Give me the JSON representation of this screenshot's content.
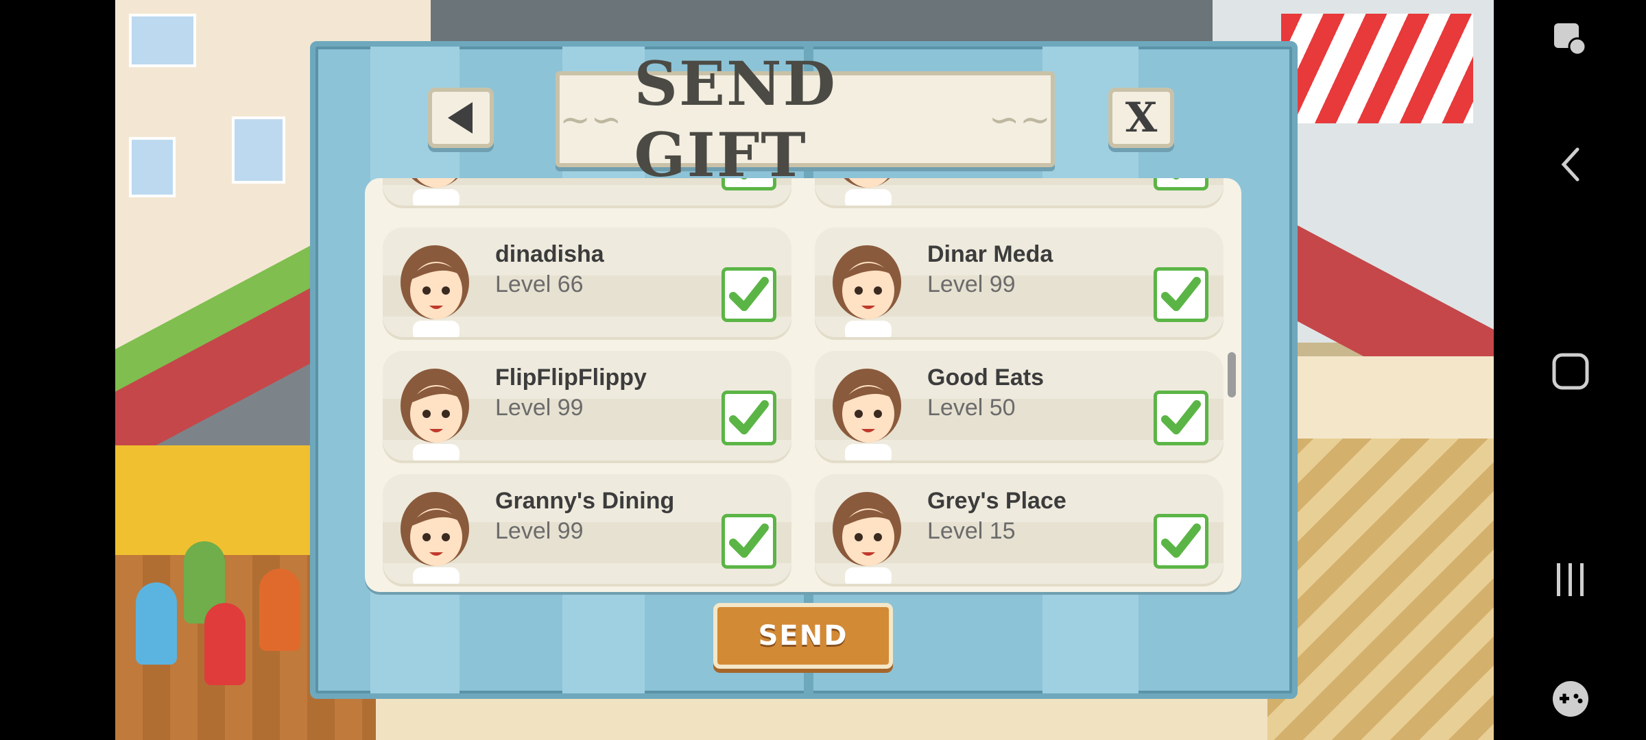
{
  "dialog": {
    "title": "SEND GIFT",
    "close_label": "X",
    "send_label": "SEND"
  },
  "friends": [
    {
      "name": "dinadisha",
      "level": "Level 66",
      "checked": true
    },
    {
      "name": "Dinar Meda",
      "level": "Level 99",
      "checked": true
    },
    {
      "name": "FlipFlipFlippy",
      "level": "Level 99",
      "checked": true
    },
    {
      "name": "Good Eats",
      "level": "Level 50",
      "checked": true
    },
    {
      "name": "Granny's Dining",
      "level": "Level 99",
      "checked": true
    },
    {
      "name": "Grey's Place",
      "level": "Level 15",
      "checked": true
    }
  ],
  "colors": {
    "dialog_bg": "#8dc3d7",
    "check_green": "#5bb546",
    "send_orange": "#d38a35"
  },
  "icons": {
    "back": "back-arrow-icon",
    "close": "close-icon",
    "check": "checkmark-icon",
    "nav_back": "chevron-left-icon",
    "nav_home": "home-square-icon",
    "nav_recents": "recents-icon",
    "game_tools": "gamepad-icon",
    "assistant": "touch-assist-icon"
  }
}
